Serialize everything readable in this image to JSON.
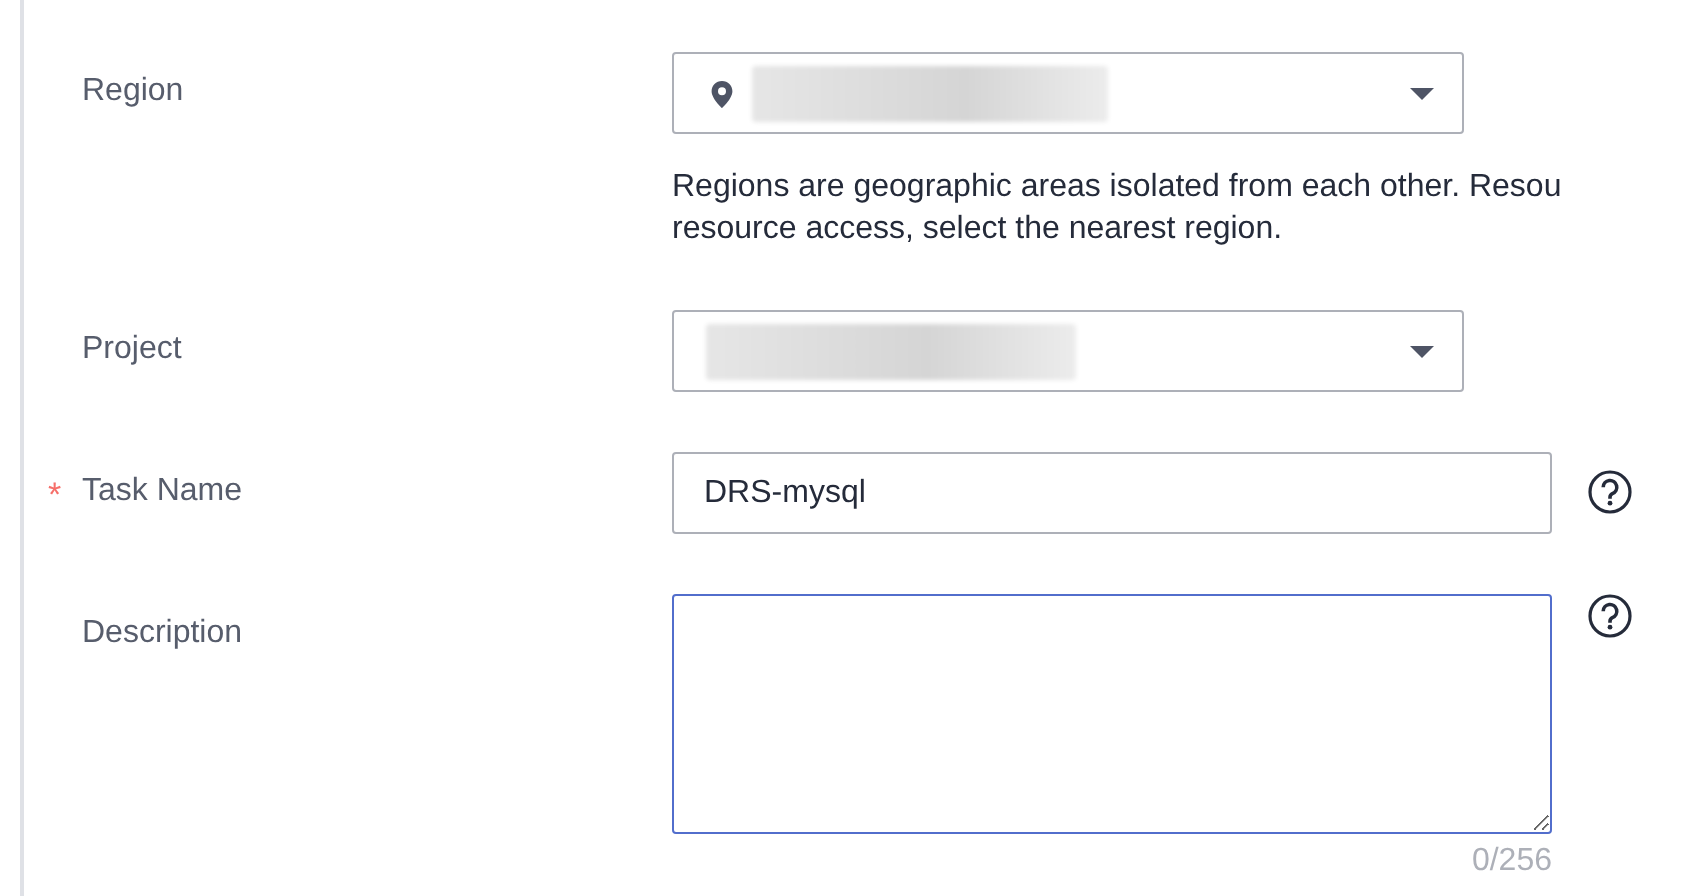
{
  "fields": [
    {
      "kind": "select",
      "label": "Region",
      "icon": true,
      "value_hidden": true,
      "hint": [
        "Regions are geographic areas isolated from each other. Resou",
        "resource access, select the nearest region."
      ]
    },
    {
      "kind": "select",
      "label": "Project",
      "value_hidden": true
    },
    {
      "kind": "input",
      "label": "Task Name",
      "required_mark": "*",
      "value": "DRS-mysql",
      "help": true
    },
    {
      "kind": "textarea",
      "label": "Description",
      "focused": true,
      "help": true,
      "counter": "0/256"
    }
  ]
}
